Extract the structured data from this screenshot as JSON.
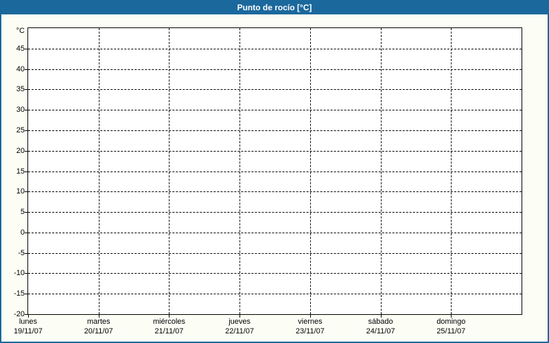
{
  "header": {
    "title": "Punto de rocío [°C]"
  },
  "colors": {
    "accent": "#1B689D",
    "title_text": "#FFFFFF",
    "page_bg": "#FCFDF5",
    "plot_bg": "#FFFFFF",
    "grid": "#000000",
    "text": "#000000"
  },
  "chart_data": {
    "type": "line",
    "title": "Punto de rocío [°C]",
    "xlabel": "",
    "ylabel": "°C",
    "ylim": [
      -20,
      50
    ],
    "y_tick_step": 5,
    "y_tick_labels": [
      45,
      40,
      35,
      30,
      25,
      20,
      15,
      10,
      5,
      0,
      -5,
      -10,
      -15,
      -20
    ],
    "x_categories": [
      {
        "day": "lunes",
        "date": "19/11/07"
      },
      {
        "day": "martes",
        "date": "20/11/07"
      },
      {
        "day": "miércoles",
        "date": "21/11/07"
      },
      {
        "day": "jueves",
        "date": "22/11/07"
      },
      {
        "day": "viernes",
        "date": "23/11/07"
      },
      {
        "day": "sábado",
        "date": "24/11/07"
      },
      {
        "day": "domingo",
        "date": "25/11/07"
      }
    ],
    "series": [],
    "grid": {
      "horizontal": "dashed",
      "vertical": "dashed"
    },
    "legend": "none"
  }
}
